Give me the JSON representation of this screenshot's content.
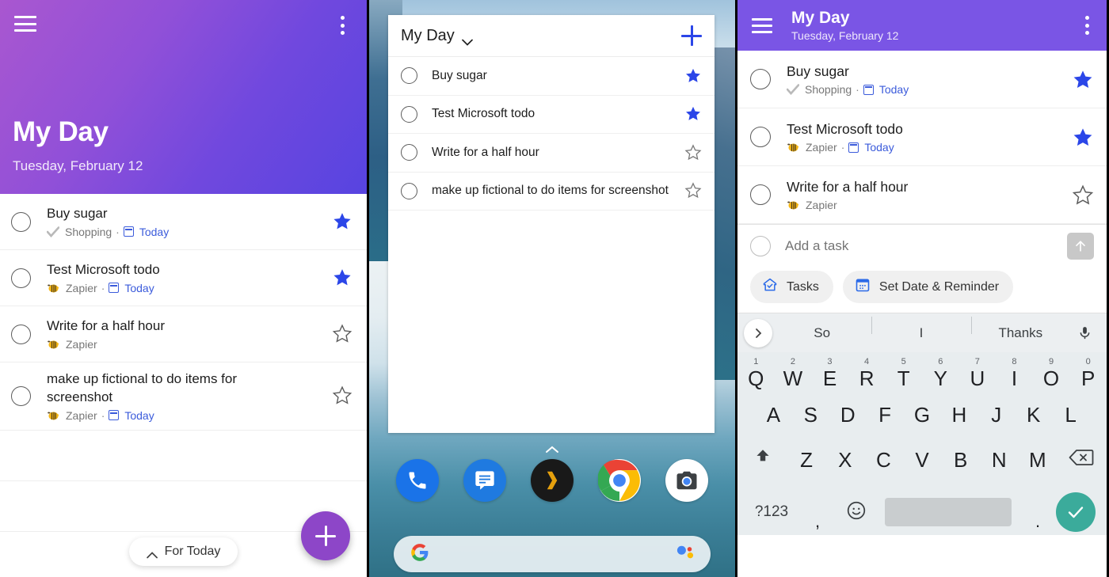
{
  "panel_left": {
    "header": {
      "menu_icon": "hamburger-icon",
      "overflow_icon": "kebab-menu-icon",
      "title": "My Day",
      "subtitle": "Tuesday, February 12",
      "gradient_from": "#a957d0",
      "gradient_to": "#5744e0"
    },
    "tasks": [
      {
        "title": "Buy sugar",
        "list_icon": "check-icon",
        "list": "Shopping",
        "separator": "·",
        "due": "Today",
        "starred": true
      },
      {
        "title": "Test Microsoft todo",
        "list_icon": "bee-icon",
        "list": "Zapier",
        "separator": "·",
        "due": "Today",
        "starred": true
      },
      {
        "title": "Write for a half hour",
        "list_icon": "bee-icon",
        "list": "Zapier",
        "separator": "",
        "due": "",
        "starred": false
      },
      {
        "title": "make up fictional to do items for screenshot",
        "list_icon": "bee-icon",
        "list": "Zapier",
        "separator": "·",
        "due": "Today",
        "starred": false
      }
    ],
    "for_today_label": "For Today",
    "fab_label": "+",
    "accent_star": "#2b46e8",
    "accent_link": "#3b5bdb",
    "fab_color": "#8d46c8"
  },
  "panel_middle": {
    "widget": {
      "title": "My Day",
      "dropdown_icon": "chevron-down-icon",
      "add_icon": "plus-icon",
      "tasks": [
        {
          "title": "Buy sugar",
          "starred": true
        },
        {
          "title": "Test Microsoft todo",
          "starred": true
        },
        {
          "title": "Write for a half hour",
          "starred": false
        },
        {
          "title": "make up fictional to do items for screenshot",
          "starred": false
        }
      ]
    },
    "dock": [
      {
        "name": "phone-icon"
      },
      {
        "name": "messages-icon"
      },
      {
        "name": "plex-icon"
      },
      {
        "name": "chrome-icon"
      },
      {
        "name": "camera-icon"
      }
    ],
    "search": {
      "logo": "google-g-icon",
      "assistant": "google-assistant-icon"
    },
    "drawer_handle": "chevron-up-icon"
  },
  "panel_right": {
    "header": {
      "menu_icon": "hamburger-icon",
      "overflow_icon": "kebab-menu-icon",
      "title": "My Day",
      "subtitle": "Tuesday, February 12",
      "color": "#7a55e5"
    },
    "tasks": [
      {
        "title": "Buy sugar",
        "list_icon": "check-icon",
        "list": "Shopping",
        "separator": "·",
        "due": "Today",
        "starred": true
      },
      {
        "title": "Test Microsoft todo",
        "list_icon": "bee-icon",
        "list": "Zapier",
        "separator": "·",
        "due": "Today",
        "starred": true
      },
      {
        "title": "Write for a half hour",
        "list_icon": "bee-icon",
        "list": "Zapier",
        "separator": "",
        "due": "",
        "starred": false
      }
    ],
    "compose": {
      "placeholder": "Add a task",
      "value": "",
      "send_icon": "arrow-up-icon",
      "chips": [
        {
          "label": "Tasks",
          "icon": "tasks-home-icon"
        },
        {
          "label": "Set Date & Reminder",
          "icon": "calendar-reminder-icon"
        }
      ]
    },
    "keyboard": {
      "suggestions": [
        "So",
        "I",
        "Thanks"
      ],
      "expand_icon": "chevron-right-icon",
      "mic_icon": "microphone-icon",
      "row1": [
        {
          "key": "Q",
          "num": "1"
        },
        {
          "key": "W",
          "num": "2"
        },
        {
          "key": "E",
          "num": "3"
        },
        {
          "key": "R",
          "num": "4"
        },
        {
          "key": "T",
          "num": "5"
        },
        {
          "key": "Y",
          "num": "6"
        },
        {
          "key": "U",
          "num": "7"
        },
        {
          "key": "I",
          "num": "8"
        },
        {
          "key": "O",
          "num": "9"
        },
        {
          "key": "P",
          "num": "0"
        }
      ],
      "row2": [
        "A",
        "S",
        "D",
        "F",
        "G",
        "H",
        "J",
        "K",
        "L"
      ],
      "row3": [
        "Z",
        "X",
        "C",
        "V",
        "B",
        "N",
        "M"
      ],
      "shift_icon": "shift-icon",
      "backspace_icon": "backspace-icon",
      "symbols_label": "?123",
      "comma": ",",
      "emoji_icon": "emoji-icon",
      "space_label": "",
      "period": ".",
      "enter_icon": "check-icon",
      "bg_color": "#e8edef",
      "enter_color": "#3bab9b"
    }
  }
}
